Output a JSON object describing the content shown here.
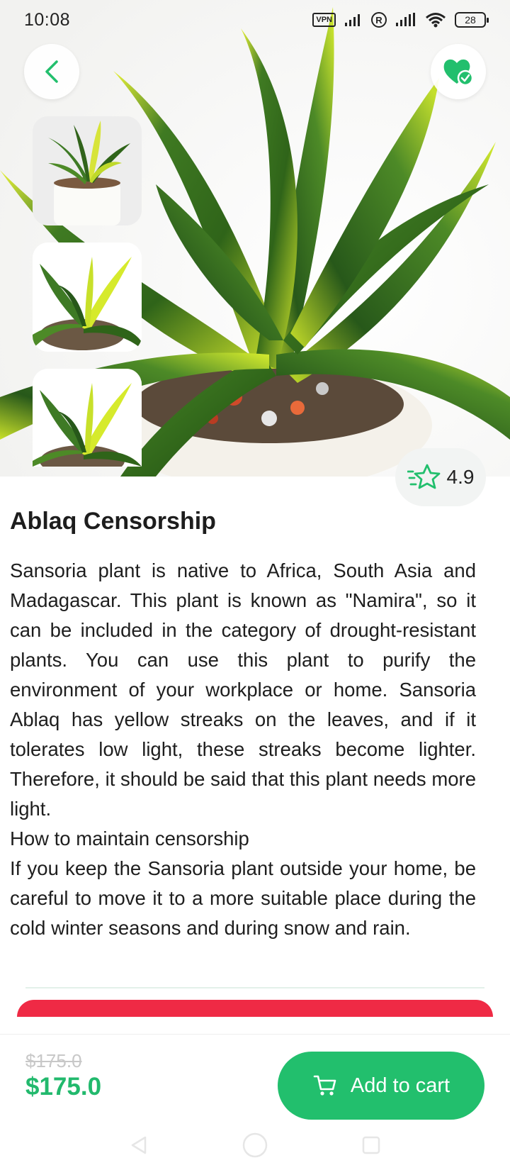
{
  "status_bar": {
    "time": "10:08",
    "vpn_label": "VPN",
    "roaming_label": "R",
    "battery": "28"
  },
  "header": {
    "back_icon": "chevron-left-icon",
    "favorite_icon": "heart-check-icon"
  },
  "gallery": {
    "thumbnails": [
      "plant-in-pot",
      "plant-top-view",
      "plant-close-up"
    ]
  },
  "rating": {
    "value": "4.9",
    "icon": "star-outline-icon"
  },
  "product": {
    "title": "Ablaq Censorship",
    "description": [
      "Sansoria plant is native to Africa, South Asia and Madagascar. This plant is known as \"Namira\", so it can be included in the category of drought-resistant plants. You can use this plant to purify the environment of your workplace or home. Sansoria Ablaq has yellow streaks on the leaves, and if it tolerates low light, these streaks become lighter. Therefore, it should be said that this plant needs more light.",
      "How to maintain censorship",
      "If you keep the Sansoria plant outside your home, be careful to move it to a more suitable place during the cold winter seasons and during snow and rain."
    ]
  },
  "purchase": {
    "old_price": "$175.0",
    "price": "$175.0",
    "add_to_cart_label": "Add to cart",
    "cart_icon": "cart-icon"
  },
  "colors": {
    "accent": "#22bf6d",
    "alert": "#ef2a45"
  }
}
